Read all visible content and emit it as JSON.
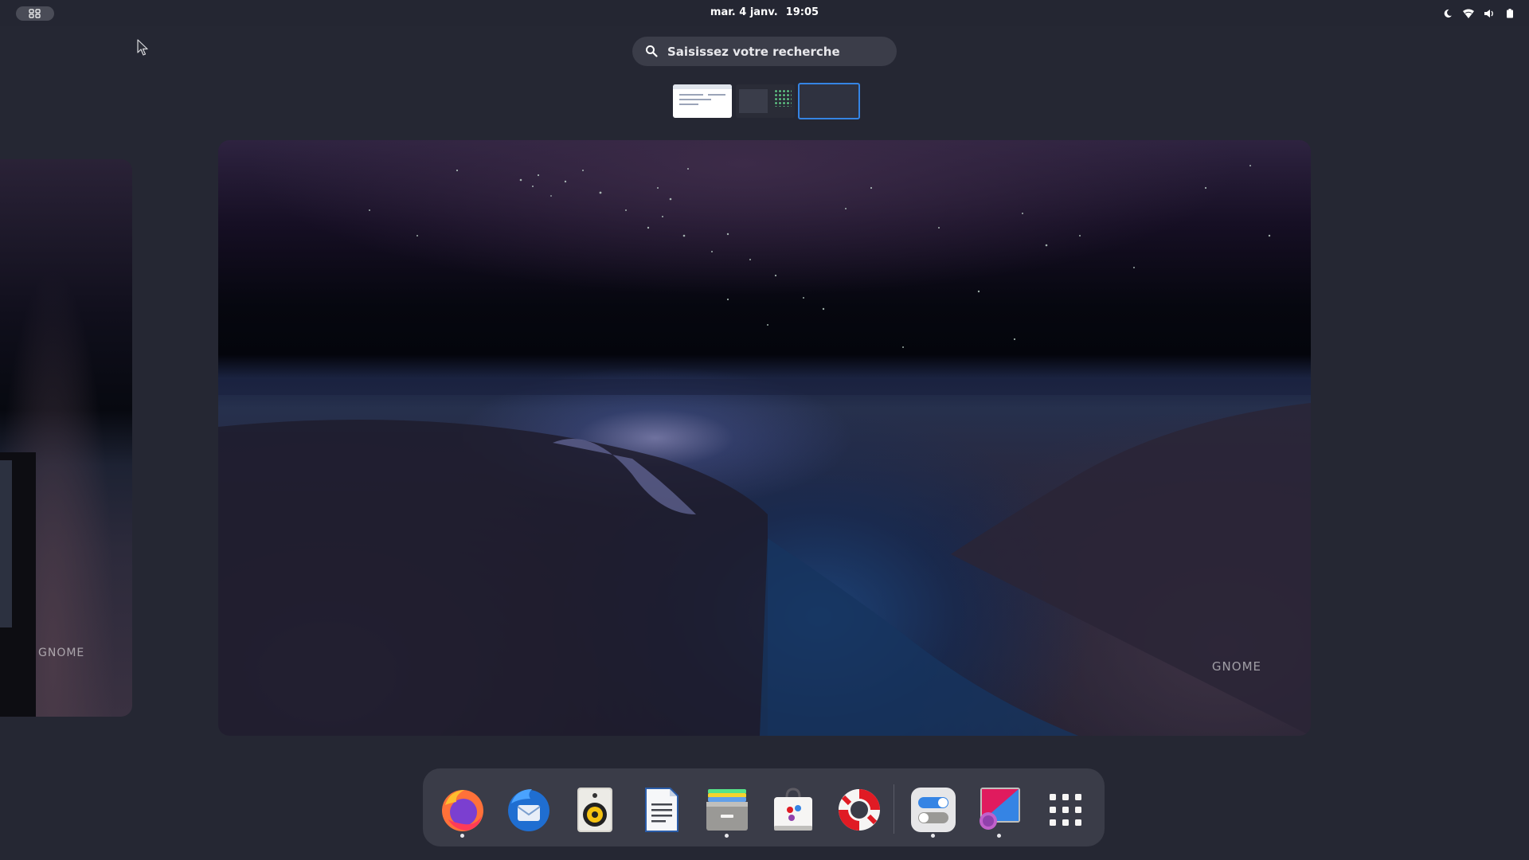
{
  "topbar": {
    "activities_icon": "activities-grid-icon",
    "date": "mar. 4 janv.",
    "time": "19:05",
    "tray_icons": [
      "night-light-icon",
      "wifi-icon",
      "volume-icon",
      "battery-icon"
    ]
  },
  "search": {
    "placeholder": "Saisissez votre recherche",
    "icon": "search-icon"
  },
  "workspaces": {
    "thumbnails": [
      "workspace-1",
      "workspace-2",
      "workspace-3"
    ],
    "active_index": 2
  },
  "wallpaper": {
    "brand_label": "GNOME"
  },
  "dash": {
    "apps": [
      {
        "name": "firefox",
        "running": true
      },
      {
        "name": "thunderbird",
        "running": false
      },
      {
        "name": "rhythmbox",
        "running": false
      },
      {
        "name": "libreoffice-writer",
        "running": false
      },
      {
        "name": "files",
        "running": true
      },
      {
        "name": "software",
        "running": false
      },
      {
        "name": "help",
        "running": false
      },
      {
        "name": "settings",
        "running": true
      },
      {
        "name": "gnome-tweaks",
        "running": true
      },
      {
        "name": "show-apps",
        "running": false
      }
    ]
  },
  "colors": {
    "panel": "#242632",
    "accent": "#3584e4",
    "dash_bg": "#3a3c48"
  }
}
